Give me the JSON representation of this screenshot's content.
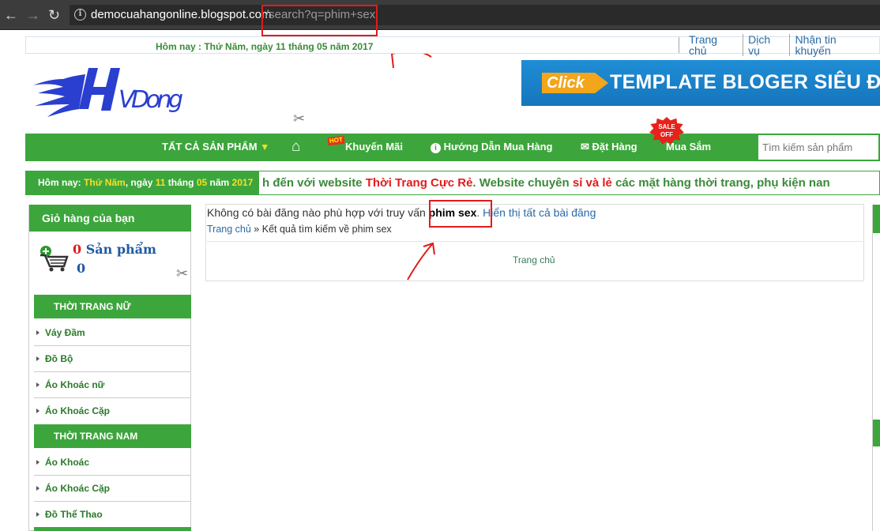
{
  "browser": {
    "host": "democuahangonline.blogspot.com",
    "path": "/search?q=phim+sex"
  },
  "topbar": {
    "date": "Hôm nay : Thứ Năm, ngày 11 tháng 05 năm 2017",
    "links": [
      "Trang chủ",
      "Dịch vụ",
      "Nhận tin khuyến"
    ]
  },
  "logo": {
    "text": "HVDong"
  },
  "banner": {
    "click": "Click",
    "text": "TEMPLATE BLOGER SIÊU ĐẸP"
  },
  "menu": {
    "all_products": "TẤT CẢ SẢN PHẨM",
    "hot_badge": "HOT",
    "promo": "Khuyến Mãi",
    "guide": "Hướng Dẫn Mua Hàng",
    "order": "Đặt Hàng",
    "sale_badge_1": "SALE",
    "sale_badge_2": "OFF",
    "shop": "Mua Sắm"
  },
  "search": {
    "placeholder": "Tìm kiếm sản phẩm"
  },
  "marquee": {
    "date_prefix": "Hôm nay:",
    "weekday": "Thứ Năm",
    "day_word": ", ngày",
    "day": "11",
    "month_word": "tháng",
    "month": "05",
    "year_word": "năm",
    "year": "2017",
    "text_1": "h đến với website ",
    "text_2": "Thời Trang Cực Rẻ",
    "text_3": ". Website chuyên ",
    "text_4": "sỉ và lẻ",
    "text_5": " các mặt hàng thời trang, phụ kiện nan"
  },
  "cart": {
    "title": "Giỏ hàng của bạn",
    "count": "0",
    "count_label": " Sản phẩm",
    "total": "0"
  },
  "categories": {
    "women_header": "THỜI TRANG NỮ",
    "women": [
      "Váy Đầm",
      "Đồ Bộ",
      "Áo Khoác nữ",
      "Áo Khoác Cặp"
    ],
    "men_header": "THỜI TRANG NAM",
    "men": [
      "Áo Khoác",
      "Áo Khoác Cặp",
      "Đồ Thể Thao"
    ]
  },
  "main": {
    "no_results": "Không có bài đăng nào phù hợp với truy vấn ",
    "query": "phim sex",
    "show_all": ". Hiển thị tất cả bài đăng",
    "breadcrumb_home": "Trang chủ",
    "breadcrumb_sep": " » ",
    "breadcrumb_current": "Kết quả tìm kiếm về phim sex",
    "home_link": "Trang chủ"
  },
  "colors": {
    "green": "#3ca63c",
    "red_annotation": "#e21b1b",
    "link": "#2a6aa6"
  }
}
